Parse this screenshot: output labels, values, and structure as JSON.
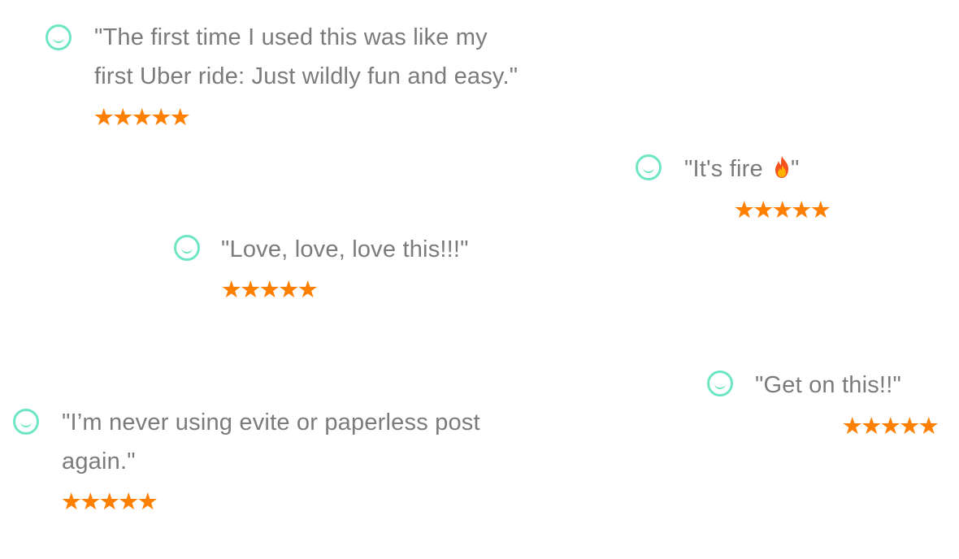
{
  "star_color": "#ff7f00",
  "avatar_color": "#6ee6c3",
  "text_color": "#7b7b7b",
  "reviews": [
    {
      "lines": [
        "\"The first time I used this was like my",
        "first Uber ride: Just wildly fun and easy.\""
      ],
      "rating": 5
    },
    {
      "text_before": "\"It's fire ",
      "emoji": "fire-icon",
      "text_after": "\"",
      "rating": 5
    },
    {
      "lines": [
        "\"Love, love, love this!!!\""
      ],
      "rating": 5
    },
    {
      "lines": [
        "\"Get on this!!\""
      ],
      "rating": 5
    },
    {
      "lines": [
        "\"I’m never using evite or paperless post",
        "again.\""
      ],
      "rating": 5
    }
  ]
}
